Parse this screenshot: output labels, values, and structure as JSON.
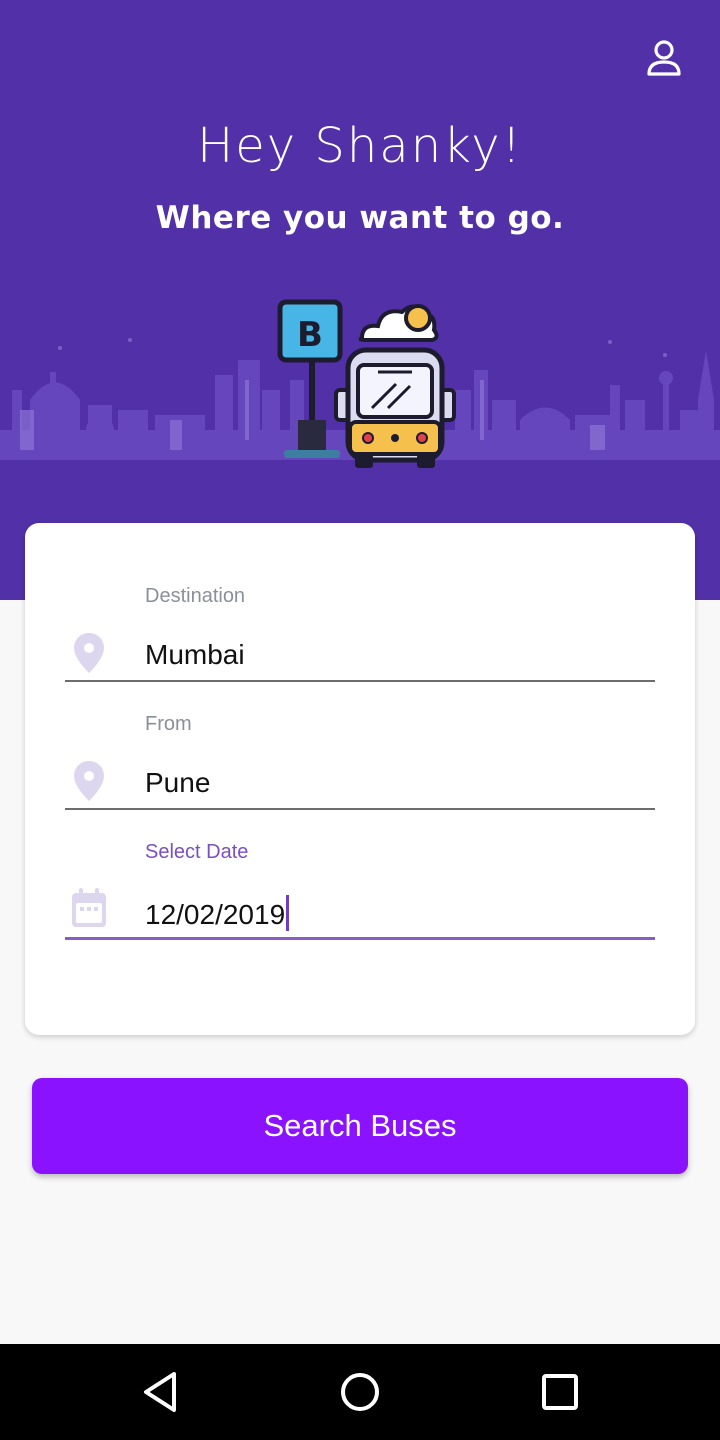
{
  "header": {
    "greeting": "Hey Shanky!",
    "subtitle": "Where you want to go."
  },
  "icons": {
    "profile": "user-icon",
    "destination": "location-pin-icon",
    "from": "location-pin-icon",
    "date": "calendar-icon",
    "bus_stop_sign": "B"
  },
  "form": {
    "destination": {
      "label": "Destination",
      "value": "Mumbai"
    },
    "from": {
      "label": "From",
      "value": "Pune"
    },
    "date": {
      "label": "Select Date",
      "value": "12/02/2019"
    }
  },
  "search_button": {
    "label": "Search Buses"
  },
  "colors": {
    "header_bg": "#5230a8",
    "accent": "#8a12ff",
    "active_label": "#7b4fc0"
  }
}
